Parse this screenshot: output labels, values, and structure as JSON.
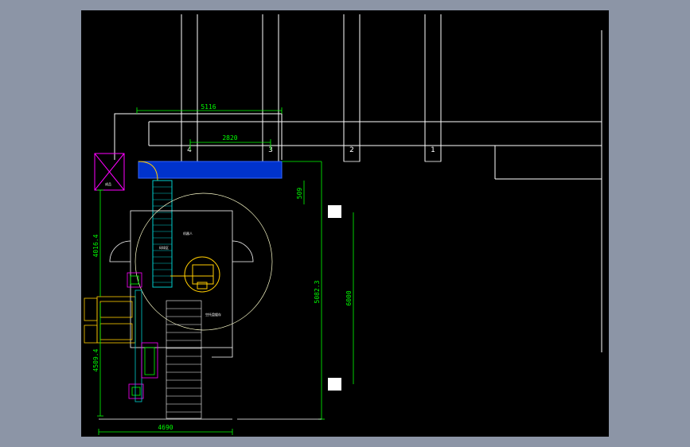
{
  "dimensions": {
    "top_width": "5116",
    "inner_width": "2820",
    "left_height_upper": "4016.4",
    "left_height_lower": "4509.4",
    "bottom_width": "4690",
    "right_total": "5082.3",
    "right_inner": "6000",
    "right_small": "509"
  },
  "grid_labels": [
    "4",
    "3",
    "2",
    "1"
  ],
  "notes": {
    "robot": "机器人",
    "area_a": "码垛区",
    "pallet": "托盘",
    "area_b": "空托盘缓存",
    "storage": "成品"
  },
  "colors": {
    "background": "#000000",
    "outer": "#8c95a6",
    "conveyor": "#0033cc",
    "dimension": "#00ff00",
    "frame": "#ff00ff",
    "equipment": "#ffcc00",
    "linework": "#ffffff"
  }
}
